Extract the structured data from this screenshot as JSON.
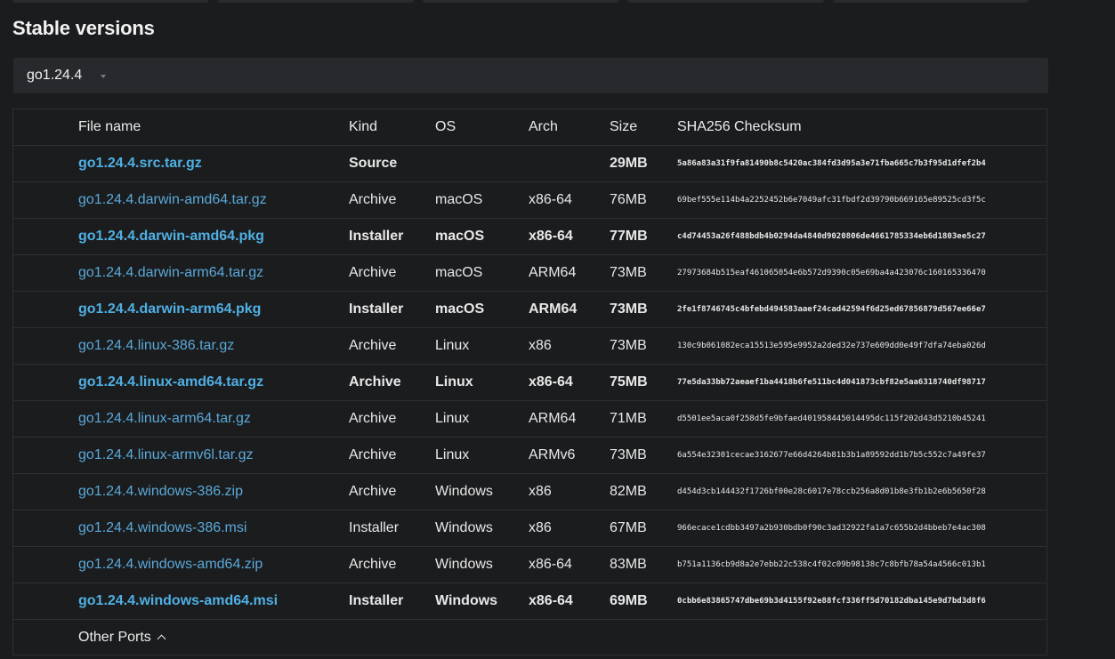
{
  "section": {
    "title": "Stable versions"
  },
  "version_select": {
    "selected": "go1.24.4"
  },
  "table": {
    "headers": {
      "file_name": "File name",
      "kind": "Kind",
      "os": "OS",
      "arch": "Arch",
      "size": "Size",
      "sha": "SHA256 Checksum"
    },
    "rows": [
      {
        "file": "go1.24.4.src.tar.gz",
        "kind": "Source",
        "os": "",
        "arch": "",
        "size": "29MB",
        "sha": "5a86a83a31f9fa81490b8c5420ac384fd3d95a3e71fba665c7b3f95d1dfef2b4",
        "featured": true
      },
      {
        "file": "go1.24.4.darwin-amd64.tar.gz",
        "kind": "Archive",
        "os": "macOS",
        "arch": "x86-64",
        "size": "76MB",
        "sha": "69bef555e114b4a2252452b6e7049afc31fbdf2d39790b669165e89525cd3f5c",
        "featured": false
      },
      {
        "file": "go1.24.4.darwin-amd64.pkg",
        "kind": "Installer",
        "os": "macOS",
        "arch": "x86-64",
        "size": "77MB",
        "sha": "c4d74453a26f488bdb4b0294da4840d9020806de4661785334eb6d1803ee5c27",
        "featured": true
      },
      {
        "file": "go1.24.4.darwin-arm64.tar.gz",
        "kind": "Archive",
        "os": "macOS",
        "arch": "ARM64",
        "size": "73MB",
        "sha": "27973684b515eaf461065054e6b572d9390c05e69ba4a423076c160165336470",
        "featured": false
      },
      {
        "file": "go1.24.4.darwin-arm64.pkg",
        "kind": "Installer",
        "os": "macOS",
        "arch": "ARM64",
        "size": "73MB",
        "sha": "2fe1f8746745c4bfebd494583aaef24cad42594f6d25ed67856879d567ee66e7",
        "featured": true
      },
      {
        "file": "go1.24.4.linux-386.tar.gz",
        "kind": "Archive",
        "os": "Linux",
        "arch": "x86",
        "size": "73MB",
        "sha": "130c9b061082eca15513e595e9952a2ded32e737e609dd0e49f7dfa74eba026d",
        "featured": false
      },
      {
        "file": "go1.24.4.linux-amd64.tar.gz",
        "kind": "Archive",
        "os": "Linux",
        "arch": "x86-64",
        "size": "75MB",
        "sha": "77e5da33bb72aeaef1ba4418b6fe511bc4d041873cbf82e5aa6318740df98717",
        "featured": true
      },
      {
        "file": "go1.24.4.linux-arm64.tar.gz",
        "kind": "Archive",
        "os": "Linux",
        "arch": "ARM64",
        "size": "71MB",
        "sha": "d5501ee5aca0f258d5fe9bfaed401958445014495dc115f202d43d5210b45241",
        "featured": false
      },
      {
        "file": "go1.24.4.linux-armv6l.tar.gz",
        "kind": "Archive",
        "os": "Linux",
        "arch": "ARMv6",
        "size": "73MB",
        "sha": "6a554e32301cecae3162677e66d4264b81b3b1a89592dd1b7b5c552c7a49fe37",
        "featured": false
      },
      {
        "file": "go1.24.4.windows-386.zip",
        "kind": "Archive",
        "os": "Windows",
        "arch": "x86",
        "size": "82MB",
        "sha": "d454d3cb144432f1726bf00e28c6017e78ccb256a8d01b8e3fb1b2e6b5650f28",
        "featured": false
      },
      {
        "file": "go1.24.4.windows-386.msi",
        "kind": "Installer",
        "os": "Windows",
        "arch": "x86",
        "size": "67MB",
        "sha": "966ecace1cdbb3497a2b930bdb0f90c3ad32922fa1a7c655b2d4bbeb7e4ac308",
        "featured": false
      },
      {
        "file": "go1.24.4.windows-amd64.zip",
        "kind": "Archive",
        "os": "Windows",
        "arch": "x86-64",
        "size": "83MB",
        "sha": "b751a1136cb9d8a2e7ebb22c538c4f02c09b98138c7c8bfb78a54a4566c013b1",
        "featured": false
      },
      {
        "file": "go1.24.4.windows-amd64.msi",
        "kind": "Installer",
        "os": "Windows",
        "arch": "x86-64",
        "size": "69MB",
        "sha": "0cbb6e83865747dbe69b3d4155f92e88fcf336ff5d70182dba145e9d7bd3d8f6",
        "featured": true
      }
    ],
    "other_ports": "Other Ports"
  }
}
